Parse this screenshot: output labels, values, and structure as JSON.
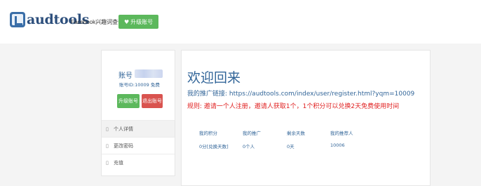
{
  "header": {
    "logo_text": "audtools",
    "nav_link": "Facebook兴趣词查询",
    "upgrade_button": "升级账号",
    "upgrade_icon": "heart-icon"
  },
  "sidebar": {
    "account_label": "账号",
    "account_id": "账号ID:10009 免费",
    "upgrade_button": "升级账号",
    "logout_button": "退出账号",
    "items": [
      {
        "label": "个人详情",
        "icon": "user-icon"
      },
      {
        "label": "更改密码",
        "icon": "lock-icon"
      },
      {
        "label": "充值",
        "icon": "credit-card-icon"
      }
    ]
  },
  "main": {
    "welcome": "欢迎回来",
    "promo_label": "我的推广链接:",
    "promo_url": "https://audtools.com/index/user/register.html?yqm=10009",
    "rule": "规则: 邀请一个人注册，邀请人获取1个，1个积分可以兑换2天免费使用时间",
    "stats": [
      {
        "label": "我的积分",
        "value": "0分[兑换天数]"
      },
      {
        "label": "我的推广",
        "value": "0个人"
      },
      {
        "label": "剩余天数",
        "value": "0天"
      },
      {
        "label": "我的推荐人",
        "value": "10006"
      }
    ]
  },
  "colors": {
    "brand": "#2d4f7c",
    "link_blue": "#336699",
    "green": "#5cb85c",
    "red": "#d9534f",
    "rule_red": "#e02020"
  }
}
